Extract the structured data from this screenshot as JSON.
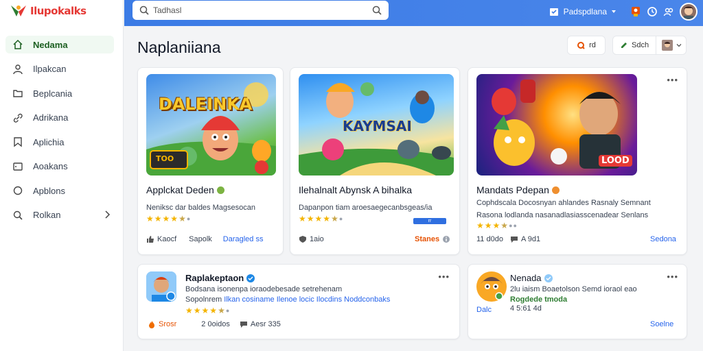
{
  "app": {
    "name": "Ilupokalks"
  },
  "sidebar": {
    "items": [
      {
        "label": "Nedama",
        "icon": "home-icon",
        "active": true
      },
      {
        "label": "Ilpakcan",
        "icon": "user-icon"
      },
      {
        "label": "Beplcania",
        "icon": "folder-icon"
      },
      {
        "label": "Adrikana",
        "icon": "link-icon"
      },
      {
        "label": "Aplichia",
        "icon": "bookmark-icon"
      },
      {
        "label": "Aoakans",
        "icon": "panel-icon"
      },
      {
        "label": "Apblons",
        "icon": "circle-icon"
      },
      {
        "label": "Rolkan",
        "icon": "settings-icon",
        "has_chevron": true
      }
    ]
  },
  "topbar": {
    "search_value": "Tadhasl",
    "account_label": "Padspdlana",
    "icons": [
      "search-icon",
      "calendar-icon",
      "badge-icon",
      "clock-icon",
      "users-icon"
    ]
  },
  "main": {
    "title": "Naplaniiana",
    "header_buttons": {
      "btn1_label": "rd",
      "btn2_label": "Sdch"
    }
  },
  "cards": [
    {
      "thumb_text": "DALEINKA",
      "thumb_badge": "TOO",
      "title": "Applckat Deden",
      "desc": "Neniksc dar baldes Magsesocan",
      "rating": 4.5,
      "foot": [
        "Kaocf",
        "Sapolk",
        "Daragled ss"
      ]
    },
    {
      "thumb_text": "KAYMSAI",
      "title": "Ilehalnalt Abynsk A bihalka",
      "desc": "Dapanpon tiam aroesaegecanbsgeas/ia",
      "rating": 4.5,
      "progress_label": "rr",
      "progress": 1,
      "foot": [
        "1aio",
        "Stanes"
      ]
    },
    {
      "thumb_text": "LOOD",
      "title": "Mandats Pdepan",
      "desc": "Cophdscala Docosnyan ahlandes Rasnaly Semnant",
      "desc2": "Rasona lodlanda nasanadlasiasscenadear Senlans",
      "rating": 3.5,
      "foot": [
        "11 d0do",
        "A 9d1",
        "Sedona"
      ]
    },
    {
      "title": "Raplakeptaon",
      "desc": "Bodsana isonenpa ioraodebesade setrehenam",
      "desc2_prefix": "Sopolnrem",
      "desc2_link": "Ilkan cosiname Ilenoe locic Ilocdins Noddconbaks",
      "rating": 4.5,
      "foot": [
        "Srosr",
        "2 0oidos",
        "Aesr 335"
      ]
    },
    {
      "title": "Nenada",
      "desc": "2lu iaism Boaetolson Semd ioraol eao",
      "desc2_green": "Rogdede tmoda",
      "desc3": "4 5:61 4d",
      "side_link": "Dalc",
      "foot": [
        "Soelne"
      ]
    }
  ],
  "colors": {
    "accent": "#3b7be5",
    "star": "#f4b400",
    "link": "#2563eb",
    "active_nav": "#1b5e20"
  }
}
